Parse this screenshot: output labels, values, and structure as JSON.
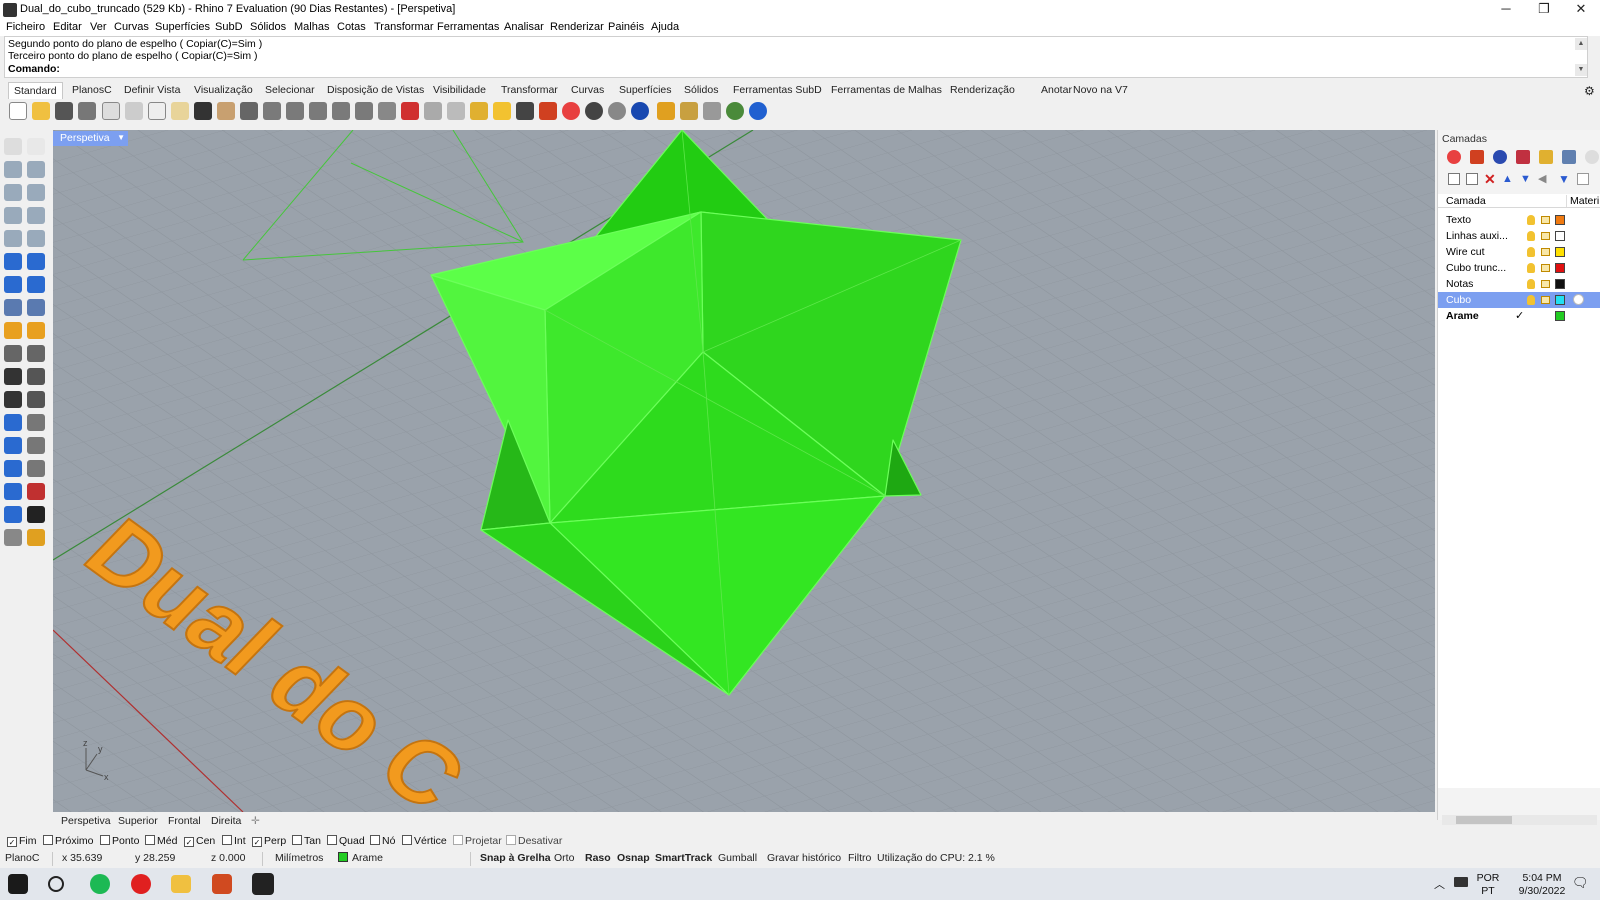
{
  "window": {
    "title": "Dual_do_cubo_truncado (529 Kb) - Rhino 7 Evaluation (90 Dias Restantes) - [Perspetiva]",
    "minimize": "─",
    "restore": "❐",
    "close": "✕"
  },
  "menu": [
    "Ficheiro",
    "Editar",
    "Ver",
    "Curvas",
    "Superfícies",
    "SubD",
    "Sólidos",
    "Malhas",
    "Cotas",
    "Transformar",
    "Ferramentas",
    "Analisar",
    "Renderizar",
    "Painéis",
    "Ajuda"
  ],
  "command": {
    "history": [
      "Segundo ponto do plano de espelho ( Copiar(C)=Sim )",
      "Terceiro ponto do plano de espelho ( Copiar(C)=Sim )"
    ],
    "prompt": "Comando:"
  },
  "toolbar_tabs": [
    "Standard",
    "PlanosC",
    "Definir Vista",
    "Visualização",
    "Selecionar",
    "Disposição de Vistas",
    "Visibilidade",
    "Transformar",
    "Curvas",
    "Superfícies",
    "Sólidos",
    "Ferramentas SubD",
    "Ferramentas de Malhas",
    "Renderização",
    "Anotar",
    "Novo na V7"
  ],
  "viewport": {
    "active_label": "Perspetiva",
    "text_3d": "Dual do C",
    "axis_labels": {
      "x": "x",
      "y": "y",
      "z": "z"
    },
    "colors": {
      "background": "#9aa2ab",
      "solid": "#33e622",
      "text": "#f29a1e"
    }
  },
  "view_tabs": [
    "Perspetiva",
    "Superior",
    "Frontal",
    "Direita"
  ],
  "view_tab_add": "✛",
  "osnaps": [
    {
      "label": "Fim",
      "checked": true
    },
    {
      "label": "Próximo",
      "checked": false
    },
    {
      "label": "Ponto",
      "checked": false
    },
    {
      "label": "Méd",
      "checked": false
    },
    {
      "label": "Cen",
      "checked": true
    },
    {
      "label": "Int",
      "checked": false
    },
    {
      "label": "Perp",
      "checked": true
    },
    {
      "label": "Tan",
      "checked": false
    },
    {
      "label": "Quad",
      "checked": false
    },
    {
      "label": "Nó",
      "checked": false
    },
    {
      "label": "Vértice",
      "checked": false
    },
    {
      "label": "Projetar",
      "checked": false
    },
    {
      "label": "Desativar",
      "checked": false
    }
  ],
  "status": {
    "cplane": "PlanoC",
    "x": "x 35.639",
    "y": "y 28.259",
    "z": "z 0.000",
    "units": "Milímetros",
    "layer": "Arame",
    "layer_color": "#22cc22",
    "snap": "Snap à Grelha",
    "ortho": "Orto",
    "planar": "Raso",
    "osnap": "Osnap",
    "smarttrack": "SmartTrack",
    "gumball": "Gumball",
    "history": "Gravar histórico",
    "filter": "Filtro",
    "cpu": "Utilização do CPU: 2.1 %"
  },
  "layers_panel": {
    "title": "Camadas",
    "col_layer": "Camada",
    "col_material": "Materi",
    "layers": [
      {
        "name": "Texto",
        "color": "#f07a10",
        "selected": false,
        "current": false
      },
      {
        "name": "Linhas auxi...",
        "color": "#ffffff",
        "selected": false,
        "current": false
      },
      {
        "name": "Wire cut",
        "color": "#ffe000",
        "selected": false,
        "current": false
      },
      {
        "name": "Cubo trunc...",
        "color": "#e01010",
        "selected": false,
        "current": false
      },
      {
        "name": "Notas",
        "color": "#111111",
        "selected": false,
        "current": false
      },
      {
        "name": "Cubo",
        "color": "#22e0f0",
        "selected": true,
        "current": false
      },
      {
        "name": "Arame",
        "color": "#22cc22",
        "selected": false,
        "current": true,
        "check": "✓"
      }
    ]
  },
  "taskbar": {
    "lang_top": "POR",
    "lang_bottom": "PT",
    "time": "5:04 PM",
    "date": "9/30/2022",
    "tray_up": "︿",
    "notification": "🗨"
  }
}
